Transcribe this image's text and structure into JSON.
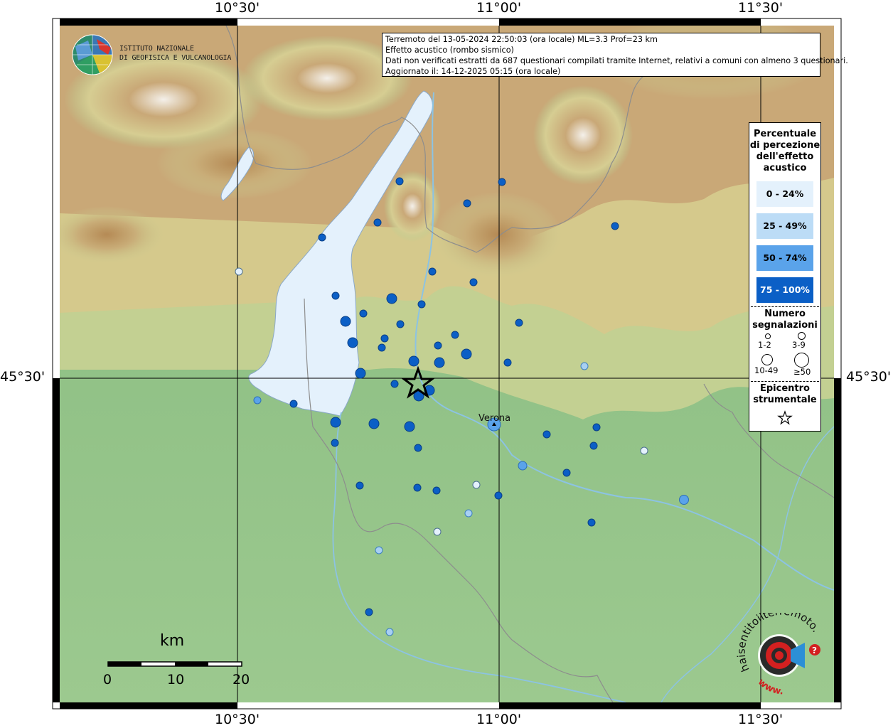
{
  "info": {
    "line1": "Terremoto del 13-05-2024 22:50:03 (ora locale) ML=3.3 Prof=23 km",
    "line2": "Effetto acustico (rombo sismico)",
    "line3": "Dati non verificati estratti da 687 questionari compilati tramite Internet, relativi a comuni con almeno 3 questionari.",
    "line4": "Aggiornato il: 14-12-2025 05:15 (ora locale)"
  },
  "logo": {
    "line1": "ISTITUTO NAZIONALE",
    "line2": "DI GEOFISICA E VULCANOLOGIA"
  },
  "axes": {
    "top": [
      "10°30'",
      "11°00'",
      "11°30'"
    ],
    "bottom": [
      "10°30'",
      "11°00'",
      "11°30'"
    ],
    "left": "45°30'",
    "right": "45°30'"
  },
  "legend": {
    "title": [
      "Percentuale",
      "di percezione",
      "dell'effetto",
      "acustico"
    ],
    "ranges": [
      {
        "label": "0 - 24%",
        "color": "#e4f1fc"
      },
      {
        "label": "25 - 49%",
        "color": "#bcdcf6"
      },
      {
        "label": "50 - 74%",
        "color": "#5aa3ea"
      },
      {
        "label": "75 - 100%",
        "color": "#0b5fc6",
        "text_color": "#ffffff"
      }
    ],
    "size_title": [
      "Numero",
      "segnalazioni"
    ],
    "sizes": [
      "1-2",
      "3-9",
      "10-49",
      "≥50"
    ],
    "epicenter_title": [
      "Epicentro",
      "strumentale"
    ]
  },
  "scalebar": {
    "unit": "km",
    "ticks": [
      "0",
      "10",
      "20"
    ]
  },
  "city": "Verona",
  "brand": {
    "text": "haisentitoilterremoto.it",
    "prefix": "www."
  }
}
